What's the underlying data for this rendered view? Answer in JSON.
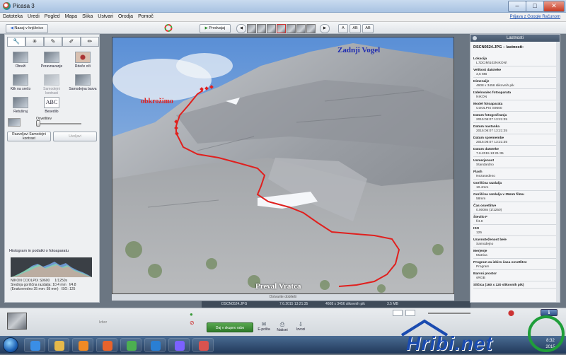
{
  "window": {
    "title": "Picasa 3",
    "minimize": "–",
    "maximize": "□",
    "close": "✕"
  },
  "menu": {
    "items": [
      "Datoteka",
      "Uredi",
      "Pogled",
      "Mapa",
      "Slika",
      "Ustvari",
      "Orodja",
      "Pomoč"
    ],
    "help_link": "Prijava z Google Računom"
  },
  "toolbar": {
    "back_label": "Nazaj v knjižnico",
    "play_label": "Predvajaj",
    "view_buttons": [
      "A",
      "AB",
      "AB"
    ]
  },
  "left_panel": {
    "tools": [
      {
        "label": "Obreži",
        "icon": "crop-icon"
      },
      {
        "label": "Poravnavanje",
        "icon": "straighten-icon"
      },
      {
        "label": "Rdeče oči",
        "icon": "redeye-icon"
      },
      {
        "label": "Klik na srečo",
        "icon": "lucky-icon"
      },
      {
        "label": "Samodejni kontrast",
        "icon": "contrast-icon"
      },
      {
        "label": "Samodejna barva",
        "icon": "color-icon"
      },
      {
        "label": "Retuširaj",
        "icon": "retouch-icon"
      },
      {
        "label": "Besedilo",
        "icon": "text-icon",
        "glyph": "ABC"
      }
    ],
    "slider_label": "Osvetlitev",
    "undo_button": "Razveljavi Samodejni kontrast",
    "redo_button": "Uveljavi",
    "histogram": {
      "title": "Histogram in podatki o fotoaparatu",
      "camera": "NIKON COOLPIX S9600",
      "shutter": "1/1250s",
      "focal": "Srednja goriščna razdalja: 10.4 mm",
      "aperture": "f/4.8",
      "equiv": "(Enakovredno 35 mm: 58 mm)",
      "iso": "ISO: 125"
    }
  },
  "photo": {
    "label_top": "Zadnji Vogel",
    "label_left": "obkrožimo",
    "label_bottom": "Preval Vratca",
    "caption_placeholder": "Dotvarite dobileši"
  },
  "status_bar": {
    "filename": "DSCN0524.JPG",
    "date": "7.6.2015 13:21:35",
    "dims": "4608 x 3456 slikovnih pik",
    "size": "3.5 MB"
  },
  "right_panel": {
    "header": "Lastnosti",
    "file": "DSCN0524.JPG – lastnosti:",
    "props": [
      {
        "label": "Lokacija",
        "value": "L:\\DCIM\\102NIKON\\"
      },
      {
        "label": "Velikost datoteke",
        "value": "3,5 MB"
      },
      {
        "label": "Dimenzije",
        "value": "4608 x 3456 slikovnih pik"
      },
      {
        "label": "Izdelovalec fotoaparata",
        "value": "NIKON"
      },
      {
        "label": "Model fotoaparata",
        "value": "COOLPIX S9600"
      },
      {
        "label": "Datum fotografiranja",
        "value": "2015:06:07 13:21:35"
      },
      {
        "label": "Datum nastanka",
        "value": "2015:06:07 13:21:35"
      },
      {
        "label": "Datum spremembe",
        "value": "2015:06:07 13:21:35"
      },
      {
        "label": "Datum datoteke",
        "value": "7.6.2015 13:21:35"
      },
      {
        "label": "Usmerjenost",
        "value": "Standardno"
      },
      {
        "label": "Flash",
        "value": "Nezasedeno"
      },
      {
        "label": "Goriščna razdalja",
        "value": "10.4mm"
      },
      {
        "label": "Goriščna razdalja v 35mm filmu",
        "value": "58mm"
      },
      {
        "label": "Čas osvetlitve",
        "value": "0.0008s (1/1250)"
      },
      {
        "label": "Število F",
        "value": "f/4.8"
      },
      {
        "label": "ISO",
        "value": "125"
      },
      {
        "label": "Uravnoteženost bele",
        "value": "Samodejno"
      },
      {
        "label": "Merjenje",
        "value": "Matrica"
      },
      {
        "label": "Program za izbiro časa osvetlitve",
        "value": "Program"
      },
      {
        "label": "Barvni prostor",
        "value": "sRGB"
      },
      {
        "label": "Sličica (160 x 120 slikovnih pik)",
        "value": ""
      }
    ]
  },
  "tray": {
    "label": "Izbor",
    "blog_button": "Daj v skupno rabo",
    "actions": [
      {
        "label": "E-pošta",
        "icon": "email-icon",
        "glyph": "✉"
      },
      {
        "label": "Natisni",
        "icon": "print-icon",
        "glyph": "⎙"
      },
      {
        "label": "Izvozi",
        "icon": "export-icon",
        "glyph": "⇩"
      }
    ]
  },
  "taskbar": {
    "time": "8:32",
    "date": "2015",
    "apps": [
      {
        "name": "ie-icon",
        "color": "#3a8ee6"
      },
      {
        "name": "explorer-icon",
        "color": "#e6b94a"
      },
      {
        "name": "media-icon",
        "color": "#f08a24"
      },
      {
        "name": "firefox-icon",
        "color": "#e8632b"
      },
      {
        "name": "chrome-icon",
        "color": "#4caf50"
      },
      {
        "name": "ie2-icon",
        "color": "#2a7fd4"
      },
      {
        "name": "app-icon",
        "color": "#7b61ff"
      },
      {
        "name": "picasa-icon",
        "color": "#d9534f"
      }
    ]
  },
  "watermark": {
    "text": "Hribi.net"
  },
  "colors": {
    "accent_red": "#e0201e",
    "label_blue": "#1e2bb0",
    "blog_green": "#3f8d37"
  }
}
